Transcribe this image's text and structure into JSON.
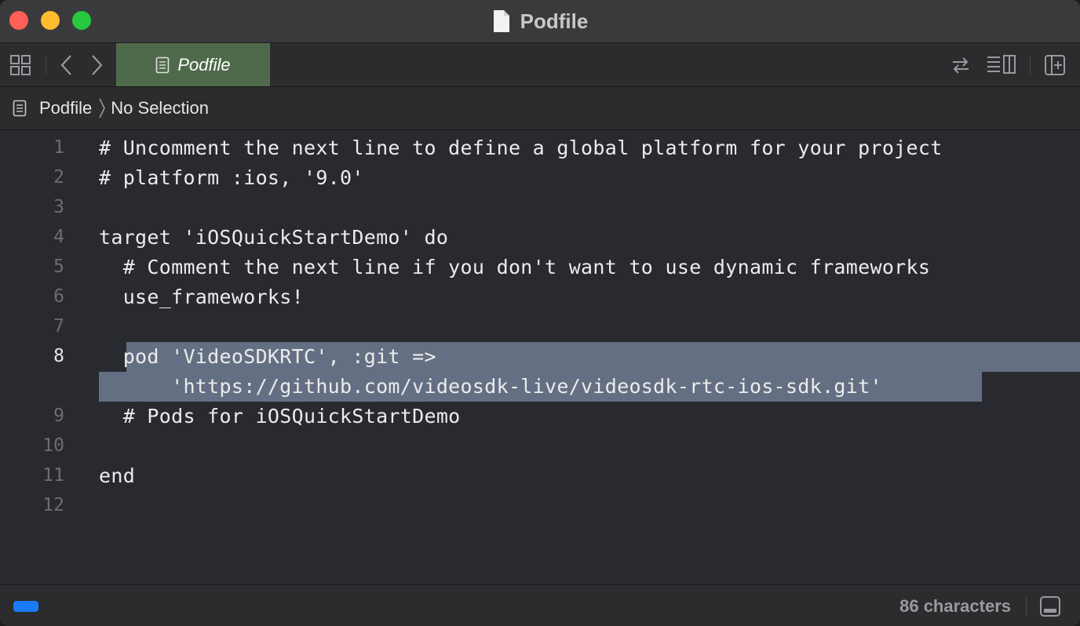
{
  "window": {
    "title": "Podfile"
  },
  "tabbar": {
    "active_tab_label": "Podfile"
  },
  "jumpbar": {
    "file": "Podfile",
    "selection": "No Selection"
  },
  "editor": {
    "lines": [
      {
        "num": "1",
        "text": "# Uncomment the next line to define a global platform for your project"
      },
      {
        "num": "2",
        "text": "# platform :ios, '9.0'"
      },
      {
        "num": "3",
        "text": ""
      },
      {
        "num": "4",
        "text": "target 'iOSQuickStartDemo' do"
      },
      {
        "num": "5",
        "text": "  # Comment the next line if you don't want to use dynamic frameworks"
      },
      {
        "num": "6",
        "text": "  use_frameworks!"
      },
      {
        "num": "7",
        "text": ""
      },
      {
        "num": "8",
        "text": "  pod 'VideoSDKRTC', :git =>"
      },
      {
        "num": "",
        "text": "      'https://github.com/videosdk-live/videosdk-rtc-ios-sdk.git'"
      },
      {
        "num": "9",
        "text": "  # Pods for iOSQuickStartDemo"
      },
      {
        "num": "10",
        "text": ""
      },
      {
        "num": "11",
        "text": "end"
      },
      {
        "num": "12",
        "text": ""
      }
    ],
    "current_line": "8"
  },
  "statusbar": {
    "char_count": "86 characters"
  },
  "colors": {
    "close": "#ff5f57",
    "minimize": "#febc2e",
    "zoom": "#28c840",
    "active_tab": "#4f6a4b",
    "selection": "#646f83",
    "status_badge": "#1a7cf5"
  },
  "icons": {
    "title": "document-icon",
    "grid": "related-items-grid-icon",
    "back": "chevron-left-icon",
    "forward": "chevron-right-icon",
    "swap": "swap-arrows-icon",
    "editor_options": "editor-options-icon",
    "add_editor": "add-editor-icon",
    "panel": "bottom-panel-icon"
  }
}
